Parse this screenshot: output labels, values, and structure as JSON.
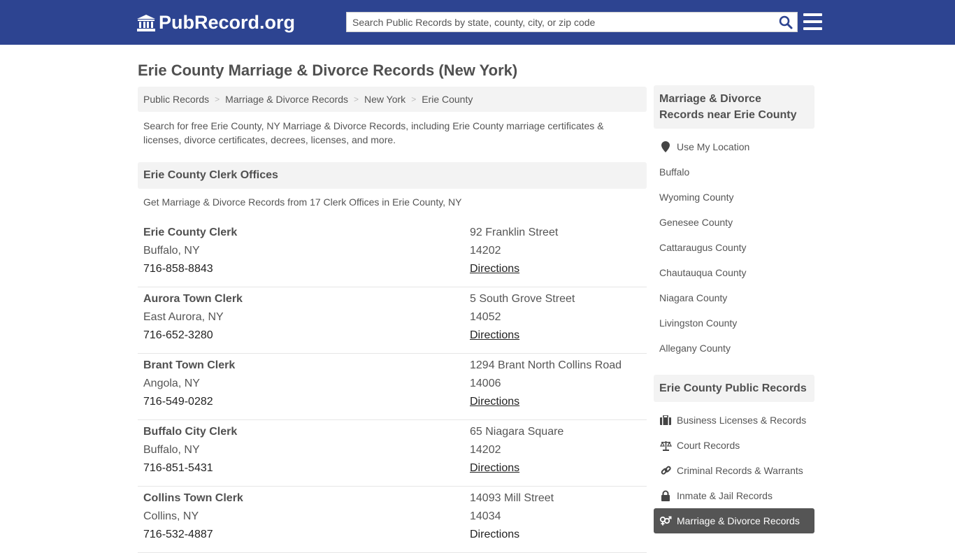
{
  "header": {
    "logo_text": "PubRecord.org",
    "search_placeholder": "Search Public Records by state, county, city, or zip code",
    "colors": {
      "brand": "#2d4491",
      "search_icon": "#2d4491"
    }
  },
  "page": {
    "title": "Erie County Marriage & Divorce Records (New York)",
    "breadcrumb": [
      "Public Records",
      "Marriage & Divorce Records",
      "New York",
      "Erie County"
    ],
    "intro": "Search for free Erie County, NY Marriage & Divorce Records, including Erie County marriage certificates & licenses, divorce certificates, decrees, licenses, and more."
  },
  "offices_section": {
    "title": "Erie County Clerk Offices",
    "subtitle": "Get Marriage & Divorce Records from 17 Clerk Offices in Erie County, NY",
    "directions_label": "Directions",
    "offices": [
      {
        "name": "Erie County Clerk",
        "city": "Buffalo, NY",
        "phone": "716-858-8843",
        "address": "92 Franklin Street",
        "zip": "14202"
      },
      {
        "name": "Aurora Town Clerk",
        "city": "East Aurora, NY",
        "phone": "716-652-3280",
        "address": "5 South Grove Street",
        "zip": "14052"
      },
      {
        "name": "Brant Town Clerk",
        "city": "Angola, NY",
        "phone": "716-549-0282",
        "address": "1294 Brant North Collins Road",
        "zip": "14006"
      },
      {
        "name": "Buffalo City Clerk",
        "city": "Buffalo, NY",
        "phone": "716-851-5431",
        "address": "65 Niagara Square",
        "zip": "14202"
      },
      {
        "name": "Collins Town Clerk",
        "city": "Collins, NY",
        "phone": "716-532-4887",
        "address": "14093 Mill Street",
        "zip": "14034"
      }
    ]
  },
  "sidebar": {
    "nearby_title": "Marriage & Divorce Records near Erie County",
    "use_location": "Use My Location",
    "nearby": [
      "Buffalo",
      "Wyoming County",
      "Genesee County",
      "Cattaraugus County",
      "Chautauqua County",
      "Niagara County",
      "Livingston County",
      "Allegany County"
    ],
    "county_title": "Erie County Public Records",
    "county_links": [
      {
        "label": "Business Licenses & Records",
        "icon": "briefcase-icon"
      },
      {
        "label": "Court Records",
        "icon": "scales-icon"
      },
      {
        "label": "Criminal Records & Warrants",
        "icon": "link-icon"
      },
      {
        "label": "Inmate & Jail Records",
        "icon": "lock-icon"
      },
      {
        "label": "Marriage & Divorce Records",
        "icon": "gender-icon",
        "active": true
      }
    ]
  }
}
